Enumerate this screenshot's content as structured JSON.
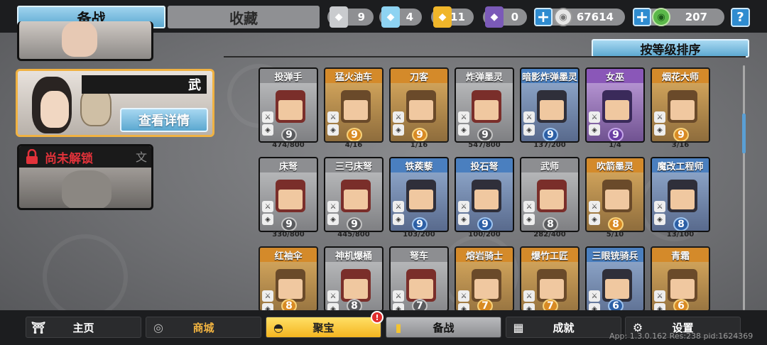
{
  "tabs": {
    "active": "备战",
    "inactive": "收藏"
  },
  "resources": [
    {
      "icon": "silver-shield-icon",
      "value": "9",
      "color": "#c9cbce"
    },
    {
      "icon": "crystal-shield-icon",
      "value": "4",
      "color": "#8ed3f2"
    },
    {
      "icon": "gold-shield-icon",
      "value": "11",
      "color": "#f0b62a"
    },
    {
      "icon": "purple-shield-icon",
      "value": "0",
      "color": "#7b5ab8"
    }
  ],
  "silver_coin": "67614",
  "jade_coin": "207",
  "help_label": "?",
  "heroes": {
    "selected": {
      "tag": "武",
      "detail_button": "查看详情"
    },
    "locked": {
      "label": "尚未解锁",
      "tag": "文"
    }
  },
  "sort_button": "按等级排序",
  "units": [
    [
      {
        "name": "投弹手",
        "tier": "gray",
        "level": "9",
        "progress": "474/800"
      },
      {
        "name": "猛火油车",
        "tier": "orange",
        "level": "9",
        "progress": "4/16"
      },
      {
        "name": "刀客",
        "tier": "orange",
        "level": "9",
        "progress": "1/16"
      },
      {
        "name": "炸弹墨灵",
        "tier": "gray",
        "level": "9",
        "progress": "547/800"
      },
      {
        "name": "暗影炸弹墨灵",
        "tier": "blue",
        "level": "9",
        "progress": "137/200"
      },
      {
        "name": "女巫",
        "tier": "purple",
        "level": "9",
        "progress": "1/4"
      },
      {
        "name": "烟花大师",
        "tier": "orange",
        "level": "9",
        "progress": "3/16"
      }
    ],
    [
      {
        "name": "床弩",
        "tier": "gray",
        "level": "9",
        "progress": "330/800"
      },
      {
        "name": "三弓床弩",
        "tier": "gray",
        "level": "9",
        "progress": "445/800"
      },
      {
        "name": "铁蒺藜",
        "tier": "blue",
        "level": "9",
        "progress": "103/200"
      },
      {
        "name": "投石弩",
        "tier": "blue",
        "level": "9",
        "progress": "100/200"
      },
      {
        "name": "武师",
        "tier": "gray",
        "level": "8",
        "progress": "282/400"
      },
      {
        "name": "吹箭墨灵",
        "tier": "orange",
        "level": "8",
        "progress": "5/10"
      },
      {
        "name": "魔改工程师",
        "tier": "blue",
        "level": "8",
        "progress": "13/100"
      }
    ],
    [
      {
        "name": "红袖伞",
        "tier": "orange",
        "level": "8",
        "progress": ""
      },
      {
        "name": "神机爆桶",
        "tier": "gray",
        "level": "8",
        "progress": ""
      },
      {
        "name": "弩车",
        "tier": "gray",
        "level": "7",
        "progress": ""
      },
      {
        "name": "熔岩骑士",
        "tier": "orange",
        "level": "7",
        "progress": ""
      },
      {
        "name": "爆竹工匠",
        "tier": "orange",
        "level": "7",
        "progress": ""
      },
      {
        "name": "三眼铳骑兵",
        "tier": "blue",
        "level": "6",
        "progress": ""
      },
      {
        "name": "青霜",
        "tier": "orange",
        "level": "6",
        "progress": ""
      }
    ]
  ],
  "nav": [
    {
      "label": "主页",
      "icon": "temple-icon"
    },
    {
      "label": "商城",
      "icon": "coins-icon"
    },
    {
      "label": "聚宝",
      "icon": "treasure-bowl-icon",
      "badge": "!"
    },
    {
      "label": "备战",
      "icon": "card-icon"
    },
    {
      "label": "成就",
      "icon": "grid-icon"
    },
    {
      "label": "设置",
      "icon": "gear-icon"
    }
  ],
  "version": "App: 1.3.0.162 Res:238 pid:1624369"
}
